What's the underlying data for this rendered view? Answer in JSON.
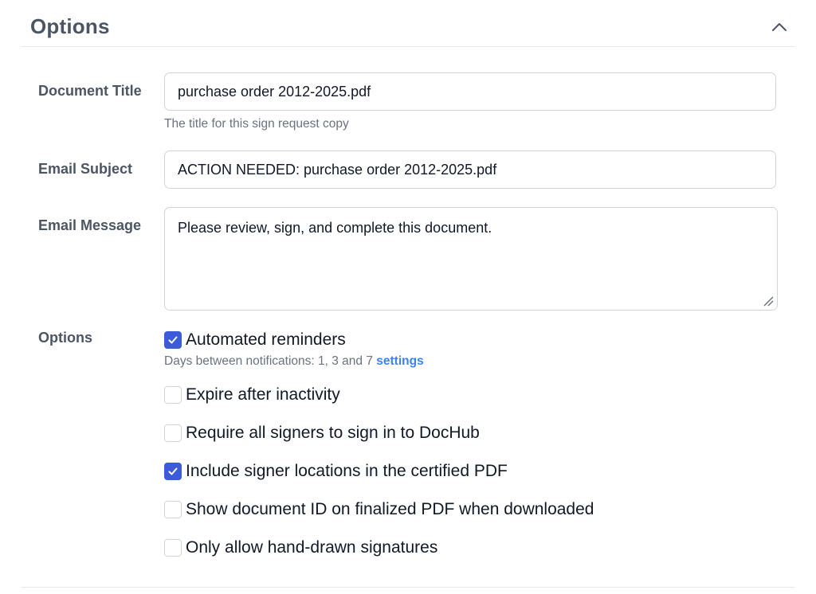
{
  "section": {
    "title": "Options",
    "collapse_icon": "chevron-up-icon"
  },
  "fields": {
    "document_title": {
      "label": "Document Title",
      "value": "purchase order 2012-2025.pdf",
      "help": "The title for this sign request copy"
    },
    "email_subject": {
      "label": "Email Subject",
      "value": "ACTION NEEDED: purchase order 2012-2025.pdf"
    },
    "email_message": {
      "label": "Email Message",
      "value": "Please review, sign, and complete this document."
    }
  },
  "options": {
    "label": "Options",
    "reminders_help": "Days between notifications: 1, 3 and 7",
    "reminders_link": "settings",
    "accent_color": "#3b5bdb",
    "items": [
      {
        "label": "Automated reminders",
        "checked": true
      },
      {
        "label": "Expire after inactivity",
        "checked": false
      },
      {
        "label": "Require all signers to sign in to DocHub",
        "checked": false
      },
      {
        "label": "Include signer locations in the certified PDF",
        "checked": true
      },
      {
        "label": "Show document ID on finalized PDF when downloaded",
        "checked": false
      },
      {
        "label": "Only allow hand-drawn signatures",
        "checked": false
      }
    ]
  }
}
